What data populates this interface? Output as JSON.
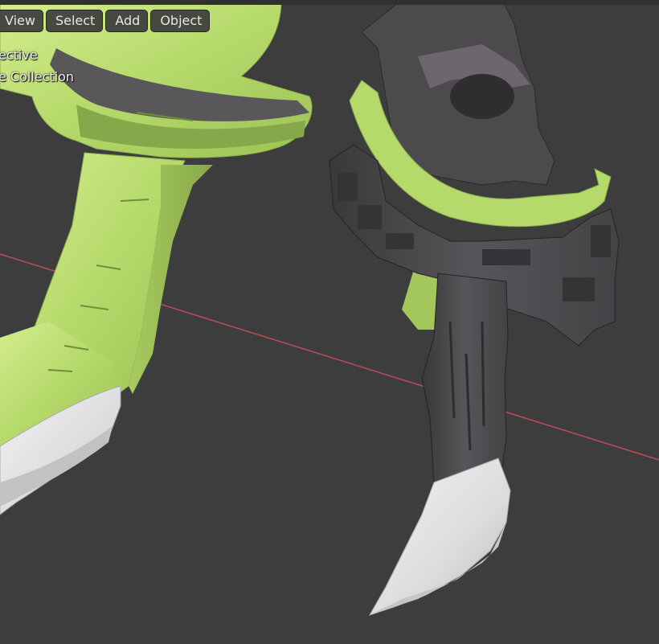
{
  "header": {
    "menu": [
      {
        "id": "view",
        "label": "View"
      },
      {
        "id": "select",
        "label": "Select"
      },
      {
        "id": "add",
        "label": "Add"
      },
      {
        "id": "object",
        "label": "Object"
      }
    ]
  },
  "overlay": {
    "view_mode": "ective",
    "collection": "e Collection"
  },
  "colors": {
    "viewport_bg": "#3d3d3d",
    "x_axis": "#b84a57",
    "model_green": "#b6d96b",
    "model_dark": "#4f4b4d",
    "blade_white": "#e9e9ea"
  }
}
